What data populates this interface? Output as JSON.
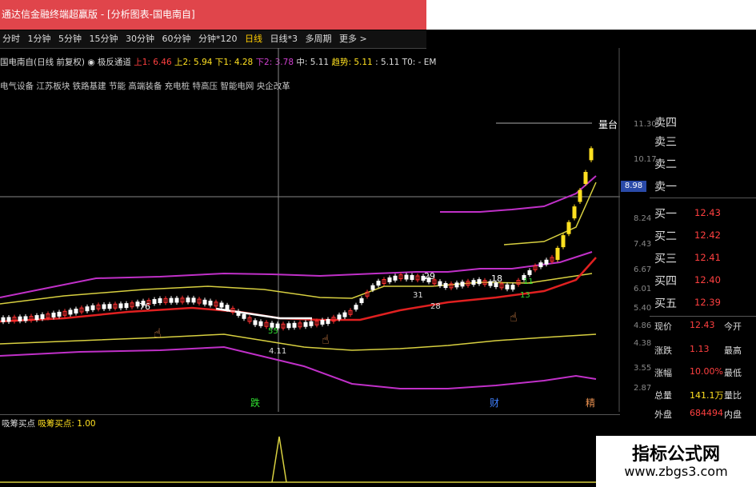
{
  "window": {
    "title": "通达信金融终端超赢版 - [分析图表-国电南自]"
  },
  "period_tabs": [
    "分时",
    "1分钟",
    "5分钟",
    "15分钟",
    "30分钟",
    "60分钟",
    "分钟*120",
    "日线",
    "日线*3",
    "多周期",
    "更多 >"
  ],
  "active_period": "日线",
  "indicator_row": {
    "stock": "国电南自(日线 前复权)",
    "indicator": "◉ 极反通道",
    "up1": "上1: 6.46",
    "up2": "上2: 5.94",
    "down1": "下1: 4.28",
    "down2": "下2: 3.78",
    "mid": "中: 5.11",
    "trend": "趋势: 5.11",
    "extra": ": 5.11",
    "t0": "T0: -",
    "em": "EM"
  },
  "sector_row": "电气设备 江苏板块 铁路基建 节能 高端装备 充电桩 特高压 智能电网 央企改革",
  "price_axis": [
    "11.30",
    "10.17",
    "8.98",
    "8.24",
    "7.43",
    "6.67",
    "6.01",
    "5.40",
    "4.86",
    "4.38",
    "3.55",
    "2.87"
  ],
  "crosshair_price": "8.98",
  "chart_annotation": "量台",
  "chart_numbers": [
    "76",
    "55",
    "4.11",
    "29",
    "18",
    "28",
    "11",
    "13",
    "31"
  ],
  "bottom_markers": [
    "跌",
    "财",
    "精"
  ],
  "order_book": {
    "sell": [
      {
        "label": "卖四",
        "price": ""
      },
      {
        "label": "卖三",
        "price": ""
      },
      {
        "label": "卖二",
        "price": ""
      },
      {
        "label": "卖一",
        "price": ""
      }
    ],
    "buy": [
      {
        "label": "买一",
        "price": "12.43"
      },
      {
        "label": "买二",
        "price": "12.42"
      },
      {
        "label": "买三",
        "price": "12.41"
      },
      {
        "label": "买四",
        "price": "12.40"
      },
      {
        "label": "买五",
        "price": "12.39"
      }
    ]
  },
  "quote": {
    "current_label": "现价",
    "current": "12.43",
    "open_label": "今开",
    "change_label": "涨跌",
    "change": "1.13",
    "high_label": "最高",
    "pct_label": "涨幅",
    "pct": "10.00%",
    "low_label": "最低",
    "vol_label": "总量",
    "vol": "141.1万",
    "ratio_label": "量比",
    "out_label": "外盘",
    "out": "684494",
    "in_label": "内盘"
  },
  "sub_indicator": {
    "name": "吸筹买点",
    "label": "吸筹买点: 1.00"
  },
  "watermark": {
    "title": "指标公式网",
    "url": "www.zbgs3.com"
  },
  "colors": {
    "title_bg": "#e0454b",
    "upper_band": "#c030c8",
    "inner_band": "#d8d040",
    "mid_line": "#e02020",
    "candle_up": "#ffffff",
    "candle_hot": "#ffe020",
    "price_red": "#ff4040"
  }
}
